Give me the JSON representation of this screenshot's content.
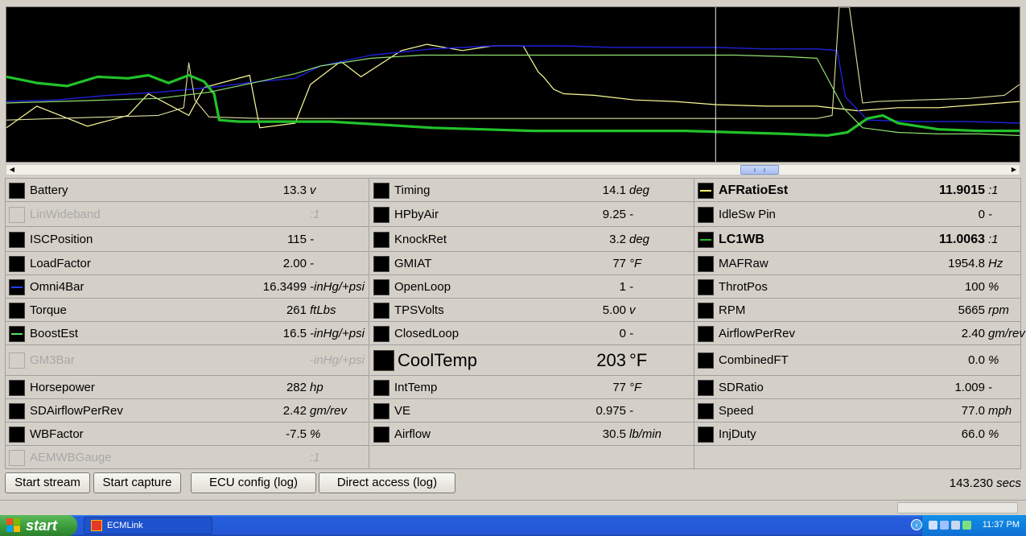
{
  "graph": {
    "cursor_pct": 70,
    "series": [
      {
        "color": "#ffff99",
        "width": 1.2,
        "points": [
          [
            0,
            78
          ],
          [
            3,
            64
          ],
          [
            8,
            77
          ],
          [
            12,
            70
          ],
          [
            14,
            56
          ],
          [
            18,
            70
          ],
          [
            19.5,
            52
          ],
          [
            24,
            44
          ],
          [
            25,
            78
          ],
          [
            28.5,
            75
          ],
          [
            30,
            50
          ],
          [
            33,
            35
          ],
          [
            35,
            45
          ],
          [
            39,
            28
          ],
          [
            41.5,
            24
          ],
          [
            45,
            28
          ],
          [
            48,
            25
          ],
          [
            51,
            25
          ],
          [
            52.5,
            42
          ],
          [
            53,
            45
          ],
          [
            54,
            53
          ],
          [
            55,
            56
          ],
          [
            58,
            57
          ],
          [
            62,
            60
          ],
          [
            66,
            61
          ],
          [
            70,
            63
          ],
          [
            75,
            64
          ],
          [
            80,
            64
          ],
          [
            84,
            67
          ],
          [
            88,
            65
          ],
          [
            92,
            65
          ],
          [
            96,
            63
          ],
          [
            100,
            61
          ]
        ]
      },
      {
        "color": "#2020dd",
        "width": 1.4,
        "points": [
          [
            0,
            61
          ],
          [
            5,
            60
          ],
          [
            10,
            57
          ],
          [
            15,
            55
          ],
          [
            20,
            52
          ],
          [
            25,
            48
          ],
          [
            28.5,
            46
          ],
          [
            31,
            38
          ],
          [
            36,
            31
          ],
          [
            42,
            27
          ],
          [
            48,
            25
          ],
          [
            52,
            25
          ],
          [
            55,
            25
          ],
          [
            60,
            26
          ],
          [
            65,
            26
          ],
          [
            70,
            26
          ],
          [
            75,
            27
          ],
          [
            78,
            27
          ],
          [
            80,
            27
          ],
          [
            82,
            28
          ],
          [
            82.8,
            58
          ],
          [
            85,
            73
          ],
          [
            90,
            74
          ],
          [
            95,
            74
          ],
          [
            100,
            75
          ]
        ]
      },
      {
        "color": "#e0e0a0",
        "width": 1.1,
        "points": [
          [
            0,
            73
          ],
          [
            5,
            72
          ],
          [
            10,
            71
          ],
          [
            15,
            70
          ],
          [
            17.5,
            65
          ],
          [
            18,
            36
          ],
          [
            18.6,
            60
          ],
          [
            20,
            71
          ],
          [
            25,
            72
          ],
          [
            30,
            72
          ],
          [
            35,
            72
          ],
          [
            40,
            72
          ],
          [
            45,
            72
          ],
          [
            50,
            72
          ],
          [
            55,
            72
          ],
          [
            60,
            72
          ],
          [
            65,
            72
          ],
          [
            70,
            72
          ],
          [
            75,
            72
          ],
          [
            80,
            72
          ],
          [
            81.5,
            70
          ],
          [
            82.2,
            0
          ],
          [
            83.2,
            0
          ],
          [
            84.5,
            62
          ],
          [
            86,
            61
          ],
          [
            90,
            60
          ],
          [
            95,
            59
          ],
          [
            98.5,
            57
          ],
          [
            100,
            50
          ]
        ]
      },
      {
        "color": "#22c22a",
        "width": 3.2,
        "points": [
          [
            0,
            45
          ],
          [
            3,
            49
          ],
          [
            6,
            51
          ],
          [
            9,
            45
          ],
          [
            12,
            46
          ],
          [
            14,
            44
          ],
          [
            16,
            49
          ],
          [
            18,
            44
          ],
          [
            19.5,
            48
          ],
          [
            20.5,
            56
          ],
          [
            21,
            73
          ],
          [
            23,
            74
          ],
          [
            27,
            74
          ],
          [
            32,
            74
          ],
          [
            37,
            76
          ],
          [
            42,
            78
          ],
          [
            47,
            79
          ],
          [
            52,
            80
          ],
          [
            57,
            80
          ],
          [
            62,
            80
          ],
          [
            67,
            80
          ],
          [
            72,
            81
          ],
          [
            77,
            82
          ],
          [
            81,
            83
          ],
          [
            83,
            81
          ],
          [
            85,
            72
          ],
          [
            86.5,
            70
          ],
          [
            88,
            75
          ],
          [
            92,
            79
          ],
          [
            96,
            80
          ],
          [
            100,
            80
          ]
        ]
      },
      {
        "color": "#90e070",
        "width": 1.2,
        "points": [
          [
            0,
            62
          ],
          [
            5,
            61
          ],
          [
            10,
            60
          ],
          [
            15,
            59
          ],
          [
            20,
            55
          ],
          [
            25,
            48
          ],
          [
            28.5,
            43
          ],
          [
            31,
            38
          ],
          [
            36,
            33
          ],
          [
            41,
            31
          ],
          [
            47,
            31
          ],
          [
            55,
            31
          ],
          [
            65,
            31
          ],
          [
            72,
            31
          ],
          [
            77,
            32
          ],
          [
            80,
            33
          ],
          [
            82.6,
            65
          ],
          [
            84.5,
            78
          ],
          [
            88,
            81
          ],
          [
            92,
            82
          ],
          [
            96,
            82
          ],
          [
            100,
            83
          ]
        ]
      }
    ]
  },
  "channels": [
    [
      {
        "name": "Battery",
        "value": "13.3",
        "unit": "v",
        "color": "#000000"
      },
      {
        "name": "LinWideband",
        "value": "",
        "unit": ":1",
        "disabled": true
      },
      {
        "name": "ISCPosition",
        "value": "115",
        "unit": "-"
      },
      {
        "name": "LoadFactor",
        "value": "2.00",
        "unit": "-"
      },
      {
        "name": "Omni4Bar",
        "value": "16.3499",
        "unit": "-inHg/+psi",
        "line": "#2040ff"
      },
      {
        "name": "Torque",
        "value": "261",
        "unit": "ftLbs"
      },
      {
        "name": "BoostEst",
        "value": "16.5",
        "unit": "-inHg/+psi",
        "line": "#5ce05c"
      },
      {
        "name": "GM3Bar",
        "value": "",
        "unit": "-inHg/+psi",
        "disabled": true
      },
      {
        "name": "Horsepower",
        "value": "282",
        "unit": "hp"
      },
      {
        "name": "SDAirflowPerRev",
        "value": "2.42",
        "unit": "gm/rev"
      },
      {
        "name": "WBFactor",
        "value": "-7.5",
        "unit": "%"
      },
      {
        "name": "AEMWBGauge",
        "value": "",
        "unit": ":1",
        "disabled": true
      }
    ],
    [
      {
        "name": "Timing",
        "value": "14.1",
        "unit": "deg"
      },
      {
        "name": "HPbyAir",
        "value": "9.25",
        "unit": "-"
      },
      {
        "name": "KnockRet",
        "value": "3.2",
        "unit": "deg"
      },
      {
        "name": "GMIAT",
        "value": "77",
        "unit": "°F"
      },
      {
        "name": "OpenLoop",
        "value": "1",
        "unit": "-"
      },
      {
        "name": "TPSVolts",
        "value": "5.00",
        "unit": "v"
      },
      {
        "name": "ClosedLoop",
        "value": "0",
        "unit": "-"
      },
      {
        "name": "CoolTemp",
        "value": "203",
        "unit": "°F",
        "big": true
      },
      {
        "name": "IntTemp",
        "value": "77",
        "unit": "°F"
      },
      {
        "name": "VE",
        "value": "0.975",
        "unit": "-"
      },
      {
        "name": "Airflow",
        "value": "30.5",
        "unit": "lb/min"
      }
    ],
    [
      {
        "name": "AFRatioEst",
        "value": "11.9015",
        "unit": ":1",
        "bold": true,
        "line": "#ffff66"
      },
      {
        "name": "IdleSw Pin",
        "value": "0",
        "unit": "-"
      },
      {
        "name": "LC1WB",
        "value": "11.0063",
        "unit": ":1",
        "bold": true,
        "line": "#22c22a"
      },
      {
        "name": "MAFRaw",
        "value": "1954.8",
        "unit": "Hz"
      },
      {
        "name": "ThrotPos",
        "value": "100",
        "unit": "%"
      },
      {
        "name": "RPM",
        "value": "5665",
        "unit": "rpm"
      },
      {
        "name": "AirflowPerRev",
        "value": "2.40",
        "unit": "gm/rev"
      },
      {
        "name": "CombinedFT",
        "value": "0.0",
        "unit": "%"
      },
      {
        "name": "SDRatio",
        "value": "1.009",
        "unit": "-"
      },
      {
        "name": "Speed",
        "value": "77.0",
        "unit": "mph"
      },
      {
        "name": "InjDuty",
        "value": "66.0",
        "unit": "%"
      }
    ]
  ],
  "buttons": {
    "start_stream": "Start stream",
    "start_capture": "Start capture",
    "ecu_config": "ECU config (log)",
    "direct_access": "Direct access (log)"
  },
  "elapsed": {
    "value": "143.230",
    "unit": "secs"
  },
  "taskbar": {
    "start_label": "start",
    "task_label": "ECMLink",
    "clock": "11:37 PM"
  }
}
